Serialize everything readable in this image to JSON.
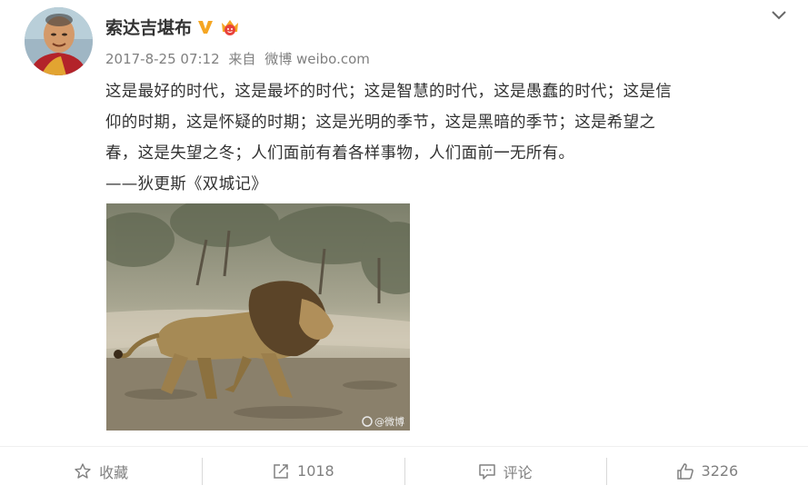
{
  "post": {
    "author": "索达吉堪布",
    "verified_icon": "verified-v-icon",
    "member_icon": "crown-badge-icon",
    "date": "2017-8-25 07:12",
    "source_prefix": "来自",
    "source": "微博 weibo.com",
    "text_lines": [
      "这是最好的时代，这是最坏的时代；这是智慧的时代，这是愚蠢的时代；这是信",
      "仰的时期，这是怀疑的时期；这是光明的季节，这是黑暗的季节；这是希望之",
      "春，这是失望之冬；人们面前有着各样事物，人们面前一无所有。",
      "——狄更斯《双城记》"
    ],
    "image_alt": "lion walking",
    "watermark": "@微博"
  },
  "actions": {
    "favorite_label": "收藏",
    "repost_count": "1018",
    "comment_label": "评论",
    "like_count": "3226"
  },
  "colors": {
    "verified": "#f5a623",
    "text": "#333333",
    "meta": "#808080"
  }
}
